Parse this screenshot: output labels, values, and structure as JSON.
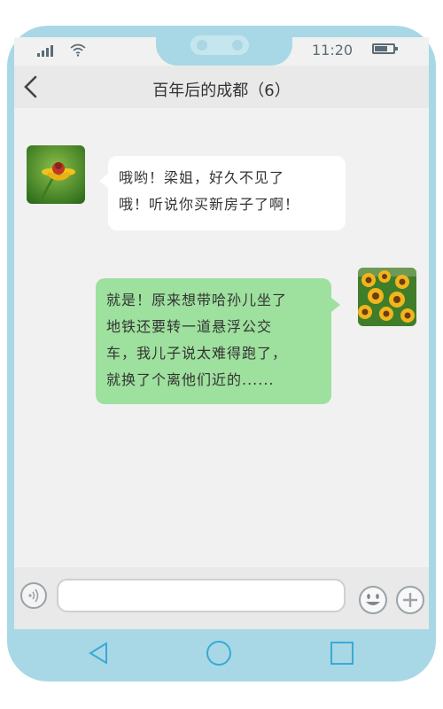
{
  "status_bar": {
    "time": "11:20"
  },
  "header": {
    "title": "百年后的成都（6）"
  },
  "messages": [
    {
      "side": "left",
      "text_line1": "哦哟！梁姐，好久不见了",
      "text_line2": "哦！听说你买新房子了啊！"
    },
    {
      "side": "right",
      "text_line1": "就是！原来想带哈孙儿坐了",
      "text_line2": "地铁还要转一道悬浮公交",
      "text_line3": "车，我儿子说太难得跑了，",
      "text_line4": "就换了个离他们近的......"
    }
  ],
  "input_bar": {
    "value": ""
  },
  "colors": {
    "frame": "#a8d8e6",
    "sent_bubble": "#9ee09e",
    "received_bubble": "#ffffff"
  }
}
